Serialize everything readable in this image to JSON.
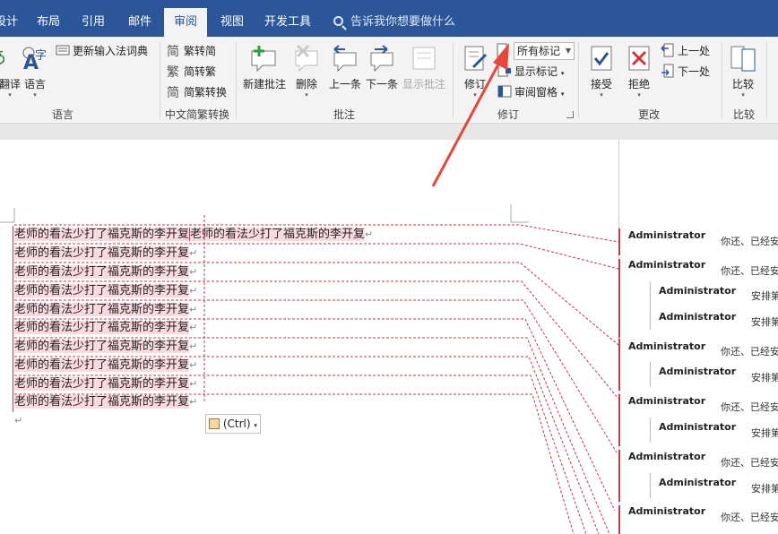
{
  "tabs": [
    {
      "label": "设计",
      "active": false
    },
    {
      "label": "布局",
      "active": false
    },
    {
      "label": "引用",
      "active": false
    },
    {
      "label": "邮件",
      "active": false
    },
    {
      "label": "审阅",
      "active": true
    },
    {
      "label": "视图",
      "active": false
    },
    {
      "label": "开发工具",
      "active": false
    }
  ],
  "tellme": {
    "placeholder": "告诉我你想要做什么"
  },
  "ribbon": {
    "language": {
      "translate": "翻译",
      "language": "语言",
      "update_ime": "更新输入法词典",
      "group": "语言"
    },
    "chinese": {
      "to_simplified": "繁转简",
      "to_traditional": "简转繁",
      "convert": "简繁转换",
      "group": "中文简繁转换"
    },
    "comments": {
      "new": "新建批注",
      "delete": "删除",
      "prev": "上一条",
      "next": "下一条",
      "show": "显示批注",
      "group": "批注"
    },
    "tracking": {
      "track": "修订",
      "markup_select": "所有标记",
      "show_markup": "显示标记",
      "review_pane": "审阅窗格",
      "group": "修订"
    },
    "changes": {
      "accept": "接受",
      "reject": "拒绝",
      "previous": "上一处",
      "next": "下一处",
      "group": "更改"
    },
    "compare": {
      "compare": "比较",
      "group": "比较"
    }
  },
  "document": {
    "first_line_original": "老师的看法少打了福克斯的李开复",
    "first_line_insert": "老师的看法少打了福克斯的李开复",
    "lines": [
      "老师的看法少打了福克斯的李开复",
      "老师的看法少打了福克斯的李开复",
      "老师的看法少打了福克斯的李开复",
      "老师的看法少打了福克斯的李开复",
      "老师的看法少打了福克斯的李开复",
      "老师的看法少打了福克斯的李开复",
      "老师的看法少打了福克斯的李开复",
      "老师的看法少打了福克斯的李开复",
      "老师的看法少打了福克斯的李开复"
    ],
    "paste_options": "(Ctrl)"
  },
  "markup": [
    {
      "author": "Administrator",
      "text": "你还、已经安",
      "reply": false
    },
    {
      "author": "Administrator",
      "text": "你还、已经安",
      "reply": false
    },
    {
      "author": "Administrator",
      "text": "安排第",
      "reply": true
    },
    {
      "author": "Administrator",
      "text": "安排第",
      "reply": true
    },
    {
      "author": "Administrator",
      "text": "你还、已经安",
      "reply": false
    },
    {
      "author": "Administrator",
      "text": "安排第",
      "reply": true
    },
    {
      "author": "Administrator",
      "text": "你还、已经安",
      "reply": false
    },
    {
      "author": "Administrator",
      "text": "安排第",
      "reply": true
    },
    {
      "author": "Administrator",
      "text": "你还、已经安",
      "reply": false
    },
    {
      "author": "Administrator",
      "text": "安排第",
      "reply": true
    },
    {
      "author": "Administrator",
      "text": "你还、已经安",
      "reply": false
    }
  ],
  "colors": {
    "accent": "#2b579a",
    "insert_highlight": "#fbd9e1",
    "revision": "#c0394f",
    "arrow": "#e8463a"
  }
}
